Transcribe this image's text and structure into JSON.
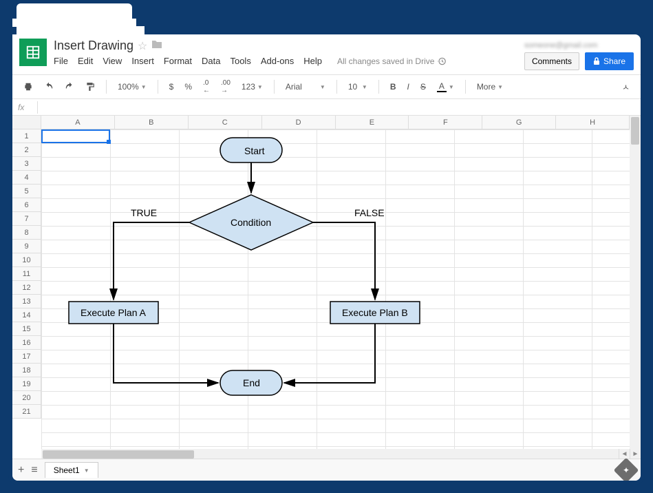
{
  "doc": {
    "title": "Insert Drawing"
  },
  "menus": [
    "File",
    "Edit",
    "View",
    "Insert",
    "Format",
    "Data",
    "Tools",
    "Add-ons",
    "Help"
  ],
  "save_status": "All changes saved in Drive",
  "header": {
    "user_email": "someone@gmail.com",
    "comments": "Comments",
    "share": "Share"
  },
  "toolbar": {
    "zoom": "100%",
    "currency": "$",
    "percent": "%",
    "dec_dec": ".0",
    "inc_dec": ".00",
    "format_123": "123",
    "font": "Arial",
    "font_size": "10",
    "more": "More"
  },
  "columns": [
    "A",
    "B",
    "C",
    "D",
    "E",
    "F",
    "G",
    "H"
  ],
  "rows": [
    "1",
    "2",
    "3",
    "4",
    "5",
    "6",
    "7",
    "8",
    "9",
    "10",
    "11",
    "12",
    "13",
    "14",
    "15",
    "16",
    "17",
    "18",
    "19",
    "20",
    "21"
  ],
  "sheet": {
    "name": "Sheet1"
  },
  "flowchart": {
    "start": "Start",
    "condition": "Condition",
    "true_label": "TRUE",
    "false_label": "FALSE",
    "plan_a": "Execute Plan A",
    "plan_b": "Execute Plan B",
    "end": "End"
  }
}
